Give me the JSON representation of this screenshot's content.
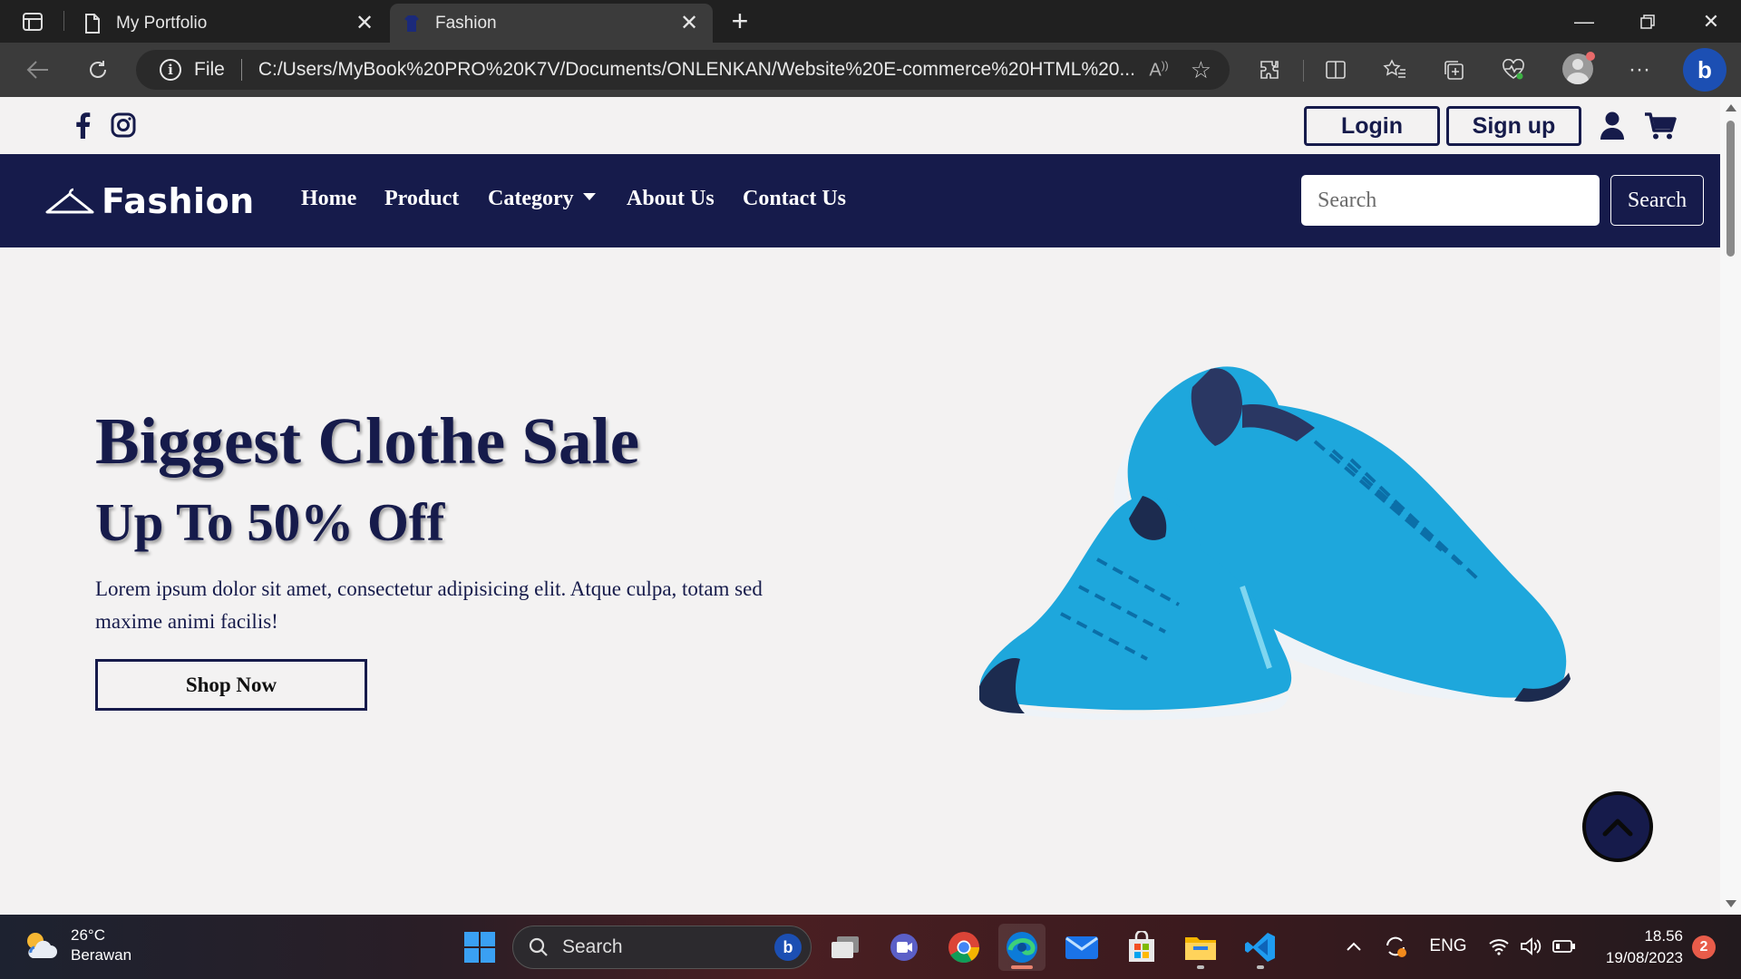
{
  "browser": {
    "tabs": [
      {
        "title": "My Portfolio",
        "active": false
      },
      {
        "title": "Fashion",
        "active": true
      }
    ],
    "address": {
      "scheme_label": "File",
      "url": "C:/Users/MyBook%20PRO%20K7V/Documents/ONLENKAN/Website%20E-commerce%20HTML%20..."
    }
  },
  "site": {
    "social": [
      "facebook-icon",
      "instagram-icon"
    ],
    "login_label": "Login",
    "signup_label": "Sign up",
    "brand": "Fashion",
    "nav": {
      "home": "Home",
      "product": "Product",
      "category": "Category",
      "about": "About Us",
      "contact": "Contact Us"
    },
    "search_placeholder": "Search",
    "search_button": "Search",
    "hero": {
      "headline": "Biggest Clothe Sale",
      "subheadline": "Up To 50% Off",
      "body": "Lorem ipsum dolor sit amet, consectetur adipisicing elit. Atque culpa, totam sed maxime animi facilis!",
      "cta": "Shop Now"
    },
    "colors": {
      "primary": "#161b4b",
      "background": "#f3f2f2",
      "shoe": "#1ea7dc"
    }
  },
  "taskbar": {
    "weather_temp": "26°C",
    "weather_desc": "Berawan",
    "search_placeholder": "Search",
    "language": "ENG",
    "time": "18.56",
    "date": "19/08/2023",
    "notification_count": "2"
  }
}
